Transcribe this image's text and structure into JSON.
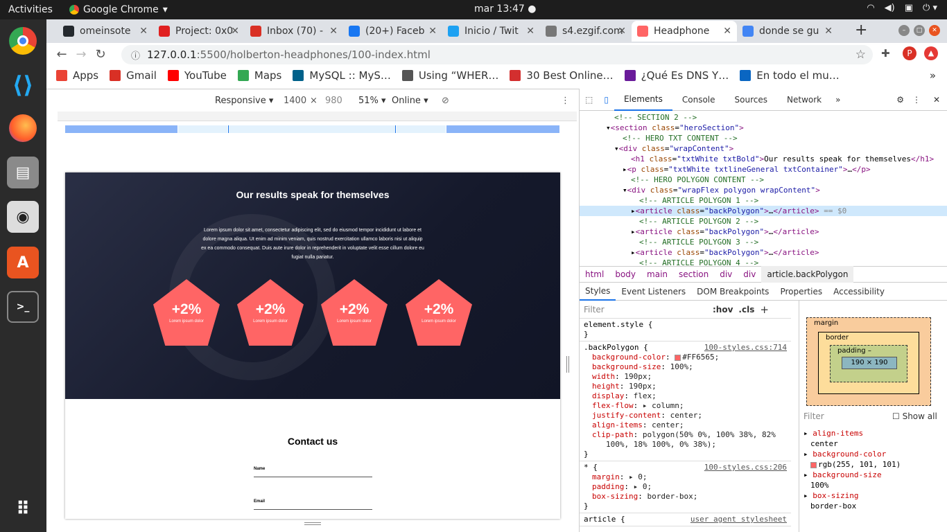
{
  "system": {
    "activities": "Activities",
    "app_name": "Google Chrome",
    "clock": "mar 13:47 ●"
  },
  "tabs": [
    {
      "title": "omeinsote",
      "icon": "github-icon",
      "color": "#24292e"
    },
    {
      "title": "Project: 0x0",
      "icon": "holberton-icon",
      "color": "#e02020"
    },
    {
      "title": "Inbox (70) -",
      "icon": "gmail-icon",
      "color": "#d93025"
    },
    {
      "title": "(20+) Faceb",
      "icon": "facebook-icon",
      "color": "#1877f2"
    },
    {
      "title": "Inicio / Twit",
      "icon": "twitter-icon",
      "color": "#1da1f2"
    },
    {
      "title": "s4.ezgif.com",
      "icon": "globe-icon",
      "color": "#777777"
    },
    {
      "title": "Headphone",
      "icon": "pentagon-icon",
      "color": "#FF6565",
      "active": true
    },
    {
      "title": "donde se gu",
      "icon": "google-icon",
      "color": "#4285f4"
    }
  ],
  "toolbar": {
    "url_host": "127.0.0.1",
    "url_path": ":5500/holberton-headphones/100-index.html",
    "profile_initial": "P"
  },
  "bookmarks": [
    {
      "label": "Apps",
      "icon": "apps-grid-icon",
      "color": "#ea4335"
    },
    {
      "label": "Gmail",
      "icon": "gmail-icon",
      "color": "#d93025"
    },
    {
      "label": "YouTube",
      "icon": "youtube-icon",
      "color": "#ff0000"
    },
    {
      "label": "Maps",
      "icon": "maps-pin-icon",
      "color": "#34a853"
    },
    {
      "label": "MySQL :: MyS…",
      "icon": "mysql-icon",
      "color": "#00618a"
    },
    {
      "label": "Using “WHER…",
      "icon": "diamond-icon",
      "color": "#555555"
    },
    {
      "label": "30 Best Online…",
      "icon": "ux-icon",
      "color": "#d32f2f"
    },
    {
      "label": "¿Qué Es DNS Y…",
      "icon": "h-icon",
      "color": "#6a1b9a"
    },
    {
      "label": "En todo el mu…",
      "icon": "linkedin-icon",
      "color": "#0a66c2"
    }
  ],
  "device_toolbar": {
    "mode": "Responsive",
    "width": "1400",
    "height": "980",
    "zoom": "51%",
    "network": "Online"
  },
  "site": {
    "hero_title": "Our results speak for themselves",
    "hero_text": "Lorem ipsum dolor sit amet, consectetur adipiscing elit, sed do eiusmod tempor incididunt ut labore et dolore magna aliqua. Ut enim ad minim veniam, quis nostrud exercitation ullamco laboris nisi ut aliquip ex ea commodo consequat. Duis aute irure dolor in reprehenderit in voluptate velit esse cillum dolore eu fugiat nulla pariatur.",
    "polygons": [
      {
        "value": "+2%",
        "label": "Lorem ipsum dolor"
      },
      {
        "value": "+2%",
        "label": "Lorem ipsum dolor"
      },
      {
        "value": "+2%",
        "label": "Lorem ipsum dolor"
      },
      {
        "value": "+2%",
        "label": "Lorem ipsum dolor"
      }
    ],
    "contact_title": "Contact us",
    "field_name": "Name",
    "field_email": "Email"
  },
  "devtools": {
    "tabs": [
      "Elements",
      "Console",
      "Sources",
      "Network"
    ],
    "dom_lines": [
      {
        "indent": 4,
        "html": "<span class='cm'>&lt;!-- SECTION 2 --&gt;</span>"
      },
      {
        "indent": 3,
        "html": "▾<span class='tg'>&lt;section </span><span class='at'>class</span>=<span class='av'>\"heroSection\"</span><span class='tg'>&gt;</span>"
      },
      {
        "indent": 5,
        "html": "<span class='cm'>&lt;!-- HERO TXT CONTENT --&gt;</span>"
      },
      {
        "indent": 4,
        "html": "▾<span class='tg'>&lt;div </span><span class='at'>class</span>=<span class='av'>\"wrapContent\"</span><span class='tg'>&gt;</span>"
      },
      {
        "indent": 6,
        "html": "<span class='tg'>&lt;h1 </span><span class='at'>class</span>=<span class='av'>\"txtWhite txtBold\"</span><span class='tg'>&gt;</span>Our results speak for themselves<span class='tg'>&lt;/h1&gt;</span>"
      },
      {
        "indent": 5,
        "html": "▸<span class='tg'>&lt;p </span><span class='at'>class</span>=<span class='av'>\"txtWhite txtlineGeneral txtContainer\"</span><span class='tg'>&gt;</span>…<span class='tg'>&lt;/p&gt;</span>"
      },
      {
        "indent": 6,
        "html": "<span class='cm'>&lt;!-- HERO POLYGON CONTENT --&gt;</span>"
      },
      {
        "indent": 5,
        "html": "▾<span class='tg'>&lt;div </span><span class='at'>class</span>=<span class='av'>\"wrapFlex polygon wrapContent\"</span><span class='tg'>&gt;</span>"
      },
      {
        "indent": 7,
        "html": "<span class='cm'>&lt;!-- ARTICLE POLYGON 1 --&gt;</span>"
      },
      {
        "indent": 6,
        "html": "▸<span class='tg'>&lt;article </span><span class='at'>class</span>=<span class='av'>\"backPolygon\"</span><span class='tg'>&gt;</span>…<span class='tg'>&lt;/article&gt;</span> <span style='color:#888'>== $0</span>",
        "selected": true
      },
      {
        "indent": 7,
        "html": "<span class='cm'>&lt;!-- ARTICLE POLYGON 2 --&gt;</span>"
      },
      {
        "indent": 6,
        "html": "▸<span class='tg'>&lt;article </span><span class='at'>class</span>=<span class='av'>\"backPolygon\"</span><span class='tg'>&gt;</span>…<span class='tg'>&lt;/article&gt;</span>"
      },
      {
        "indent": 7,
        "html": "<span class='cm'>&lt;!-- ARTICLE POLYGON 3 --&gt;</span>"
      },
      {
        "indent": 6,
        "html": "▸<span class='tg'>&lt;article </span><span class='at'>class</span>=<span class='av'>\"backPolygon\"</span><span class='tg'>&gt;</span>…<span class='tg'>&lt;/article&gt;</span>"
      },
      {
        "indent": 7,
        "html": "<span class='cm'>&lt;!-- ARTICLE POLYGON 4 --&gt;</span>"
      }
    ],
    "breadcrumbs": [
      "html",
      "body",
      "main",
      "section",
      "div",
      "div",
      "article.backPolygon"
    ],
    "style_tabs": [
      "Styles",
      "Event Listeners",
      "DOM Breakpoints",
      "Properties",
      "Accessibility"
    ],
    "filter_placeholder": "Filter",
    "hov": ":hov",
    "cls": ".cls",
    "rules": [
      {
        "selector": "element.style {",
        "source": "",
        "props": []
      },
      {
        "selector": ".backPolygon {",
        "source": "100-styles.css:714",
        "props": [
          {
            "name": "background-color",
            "value": "#FF6565;",
            "swatch": true
          },
          {
            "name": "background-size",
            "value": "100%;"
          },
          {
            "name": "width",
            "value": "190px;"
          },
          {
            "name": "height",
            "value": "190px;"
          },
          {
            "name": "display",
            "value": "flex;"
          },
          {
            "name": "flex-flow",
            "value": "▸ column;"
          },
          {
            "name": "justify-content",
            "value": "center;"
          },
          {
            "name": "align-items",
            "value": "center;"
          },
          {
            "name": "clip-path",
            "value": "polygon(50% 0%, 100% 38%, 82%"
          },
          {
            "name": "",
            "value": "  100%, 18% 100%, 0% 38%);"
          }
        ]
      },
      {
        "selector": "* {",
        "source": "100-styles.css:206",
        "props": [
          {
            "name": "margin",
            "value": "▸ 0;"
          },
          {
            "name": "padding",
            "value": "▸ 0;"
          },
          {
            "name": "box-sizing",
            "value": "border-box;"
          }
        ]
      },
      {
        "selector": "article {",
        "source": "user agent stylesheet",
        "props": []
      }
    ],
    "box_model": {
      "margin": "margin",
      "border": "border",
      "padding": "padding –",
      "content": "190 × 190",
      "dash": "–"
    },
    "computed_filter": "Filter",
    "show_all": "Show all",
    "computed": [
      {
        "name": "align-items",
        "value": "center"
      },
      {
        "name": "background-color",
        "value": "rgb(255, 101, 101)"
      },
      {
        "name": "background-size",
        "value": "100%"
      },
      {
        "name": "box-sizing",
        "value": "border-box"
      }
    ]
  }
}
